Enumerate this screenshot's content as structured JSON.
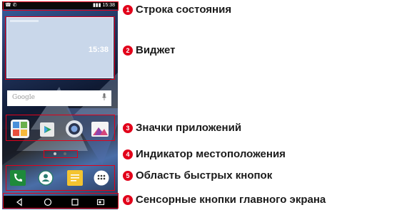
{
  "phone": {
    "status_bar": {
      "left_icons": "☎ ✆",
      "signal": "▮▮▮",
      "time": "15:38"
    },
    "widget": {
      "time": "15:38"
    },
    "search": {
      "placeholder": "Google"
    },
    "apps": [
      "contacts-app-icon",
      "play-store-icon",
      "camera-icon",
      "gallery-icon"
    ],
    "quick_buttons": [
      "phone-icon",
      "contacts-icon",
      "messages-icon",
      "apps-grid-icon"
    ],
    "nav_buttons": [
      "back-icon",
      "home-icon",
      "recents-icon",
      "dual-window-icon"
    ]
  },
  "callouts": [
    {
      "number": "1",
      "label": "Строка состояния"
    },
    {
      "number": "2",
      "label": "Виджет"
    },
    {
      "number": "3",
      "label": "Значки приложений"
    },
    {
      "number": "4",
      "label": "Индикатор местоположения"
    },
    {
      "number": "5",
      "label": "Область быстрых кнопок"
    },
    {
      "number": "6",
      "label": "Сенсорные кнопки главного экрана"
    }
  ],
  "colors": {
    "accent_red": "#e2001a",
    "phone_green": "#1e8a3a",
    "message_yellow": "#f4c430"
  }
}
